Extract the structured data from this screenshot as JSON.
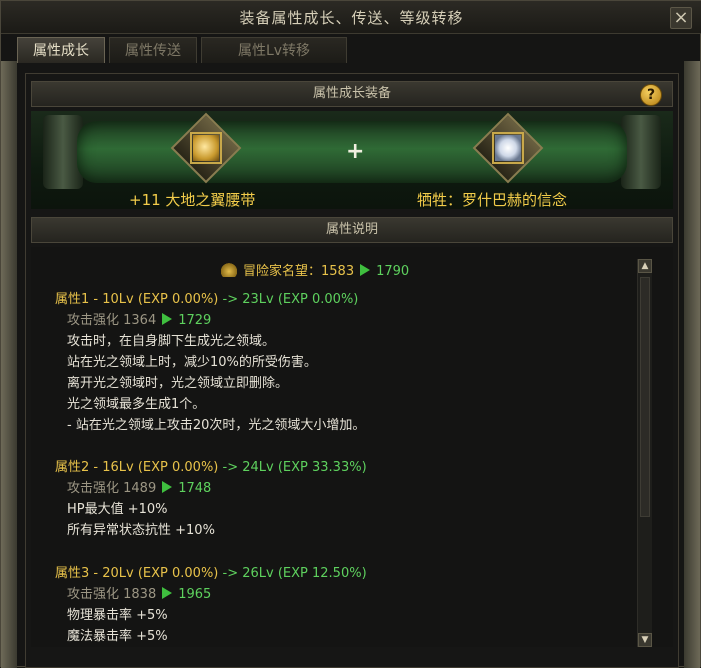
{
  "window": {
    "title": "装备属性成长、传送、等级转移",
    "close_label": "×"
  },
  "tabs": [
    {
      "label": "属性成长"
    },
    {
      "label": "属性传送"
    },
    {
      "label": "属性Lv转移"
    }
  ],
  "growth_section": {
    "header": "属性成长装备",
    "help_label": "?",
    "plus": "+",
    "left_item_name": "+11 大地之翼腰带",
    "right_item_name": "牺牲：罗什巴赫的信念"
  },
  "desc_section": {
    "header": "属性说明",
    "fame": {
      "label": "冒险家名望：",
      "from": "1583",
      "to": "1790"
    },
    "attributes": [
      {
        "title": "属性1 - 10Lv (EXP 0.00%)",
        "arrow": " -> ",
        "target": "23Lv (EXP 0.00%)",
        "stat_label": "攻击强化 ",
        "stat_from": "1364",
        "stat_to": "1729",
        "lines": [
          "攻击时，在自身脚下生成光之领域。",
          "站在光之领域上时，减少10%的所受伤害。",
          "离开光之领域时，光之领域立即删除。",
          "光之领域最多生成1个。",
          "- 站在光之领域上攻击20次时，光之领域大小增加。"
        ]
      },
      {
        "title": "属性2 - 16Lv (EXP 0.00%)",
        "arrow": " -> ",
        "target": "24Lv (EXP 33.33%)",
        "stat_label": "攻击强化 ",
        "stat_from": "1489",
        "stat_to": "1748",
        "lines": [
          "HP最大值 +10%",
          "所有异常状态抗性 +10%"
        ]
      },
      {
        "title": "属性3 - 20Lv (EXP 0.00%)",
        "arrow": " -> ",
        "target": "26Lv (EXP 12.50%)",
        "stat_label": "攻击强化 ",
        "stat_from": "1838",
        "stat_to": "1965",
        "lines": [
          "物理暴击率 +5%",
          "魔法暴击率 +5%"
        ]
      }
    ]
  },
  "scrollbar": {
    "up": "▲",
    "down": "▼"
  }
}
